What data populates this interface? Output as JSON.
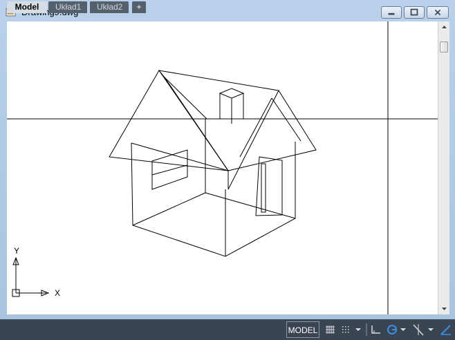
{
  "window": {
    "title": "Drawing9.dwg",
    "icons": {
      "app": "autocad-drawing-icon",
      "minimize": "minimize-icon",
      "maximize": "maximize-icon",
      "close": "close-icon"
    }
  },
  "canvas": {
    "background": "#ffffff",
    "ucs": {
      "x_label": "X",
      "y_label": "Y"
    }
  },
  "layout_tabs": [
    {
      "label": "Model",
      "active": true
    },
    {
      "label": "Układ1",
      "active": false
    },
    {
      "label": "Układ2",
      "active": false
    },
    {
      "label": "+",
      "active": false
    }
  ],
  "status_bar": {
    "space_label": "MODEL",
    "icons": [
      "grid-display-icon",
      "snap-mode-icon",
      "dropdown-chevron-icon",
      "ortho-mode-icon",
      "polar-tracking-icon",
      "dropdown-chevron-icon",
      "isodraft-icon",
      "dropdown-chevron-icon",
      "object-snap-tracking-icon"
    ],
    "accent": "#3a8ee6"
  }
}
